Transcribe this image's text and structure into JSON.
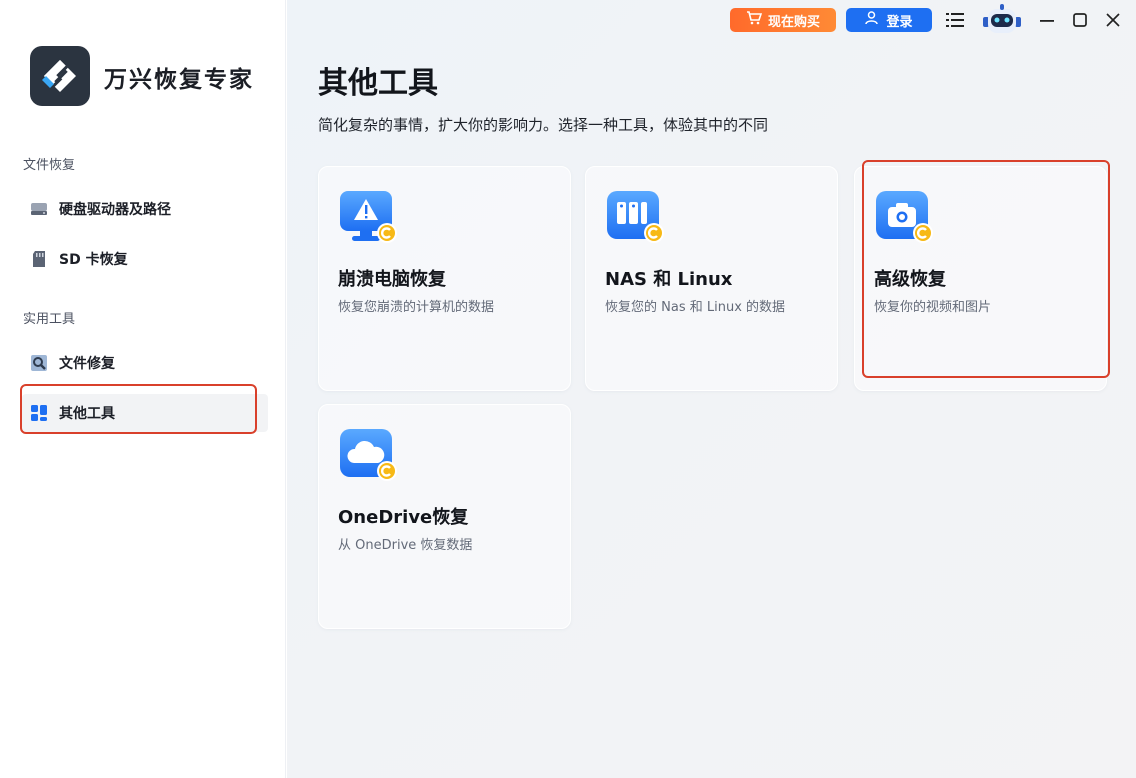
{
  "app": {
    "title": "万兴恢复专家",
    "logo_icon": "wondershare-recoverit-logo"
  },
  "topbar": {
    "buy_label": "现在购买",
    "buy_icon": "cart-icon",
    "login_label": "登录",
    "login_icon": "user-icon",
    "menu_icon": "hamburger-menu-icon",
    "assistant_icon": "robot-assistant-icon",
    "minimize_icon": "minimize-icon",
    "maximize_icon": "maximize-icon",
    "close_icon": "close-icon"
  },
  "sidebar": {
    "sections": [
      {
        "label": "文件恢复",
        "items": [
          {
            "label": "硬盘驱动器及路径",
            "icon": "hard-drive-icon"
          },
          {
            "label": "SD 卡恢复",
            "icon": "sd-card-icon"
          }
        ]
      },
      {
        "label": "实用工具",
        "items": [
          {
            "label": "文件修复",
            "icon": "file-repair-icon"
          },
          {
            "label": "其他工具",
            "icon": "grid-tools-icon",
            "active": true
          }
        ]
      }
    ]
  },
  "main": {
    "title": "其他工具",
    "subtitle": "简化复杂的事情，扩大你的影响力。选择一种工具，体验其中的不同",
    "cards": [
      {
        "title": "崩溃电脑恢复",
        "desc": "恢复您崩溃的计算机的数据",
        "icon": "crashed-computer-icon"
      },
      {
        "title": "NAS 和 Linux",
        "desc": "恢复您的 Nas 和 Linux 的数据",
        "icon": "nas-server-icon"
      },
      {
        "title": "高级恢复",
        "desc": "恢复你的视频和图片",
        "icon": "camera-icon"
      },
      {
        "title": "OneDrive恢复",
        "desc": "从 OneDrive 恢复数据",
        "icon": "cloud-icon"
      }
    ],
    "premium_badge_icon": "premium-c-badge-icon"
  },
  "colors": {
    "accent_blue": "#1e6ff2",
    "buy_orange": "#ff7a2f",
    "highlight_red": "#d9402b",
    "premium_yellow": "#f7b916"
  }
}
